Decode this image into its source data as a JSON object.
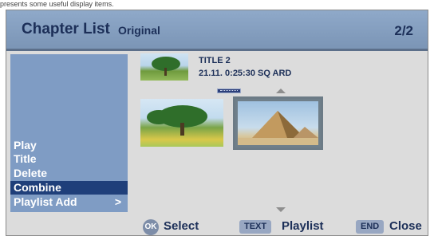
{
  "caption": "presents some useful display items.",
  "header": {
    "title": "Chapter List",
    "subtitle": "Original",
    "page": "2/2"
  },
  "menu": {
    "items": [
      {
        "label": "Play",
        "selected": false
      },
      {
        "label": "Title",
        "selected": false
      },
      {
        "label": "Delete",
        "selected": false
      },
      {
        "label": "Combine",
        "selected": true
      },
      {
        "label": "Playlist Add",
        "selected": false,
        "chevron": ">"
      }
    ]
  },
  "info": {
    "title": "TITLE 2",
    "details": "21.11.  0:25:30   SQ  ARD"
  },
  "footer": {
    "ok_key": "OK",
    "ok_label": "Select",
    "text_key": "TEXT",
    "text_label": "Playlist",
    "end_key": "END",
    "end_label": "Close"
  },
  "colors": {
    "header": "#7b95b6",
    "menu": "#7f9cc4",
    "selected": "#1f3f7a",
    "text": "#1c2f58"
  }
}
